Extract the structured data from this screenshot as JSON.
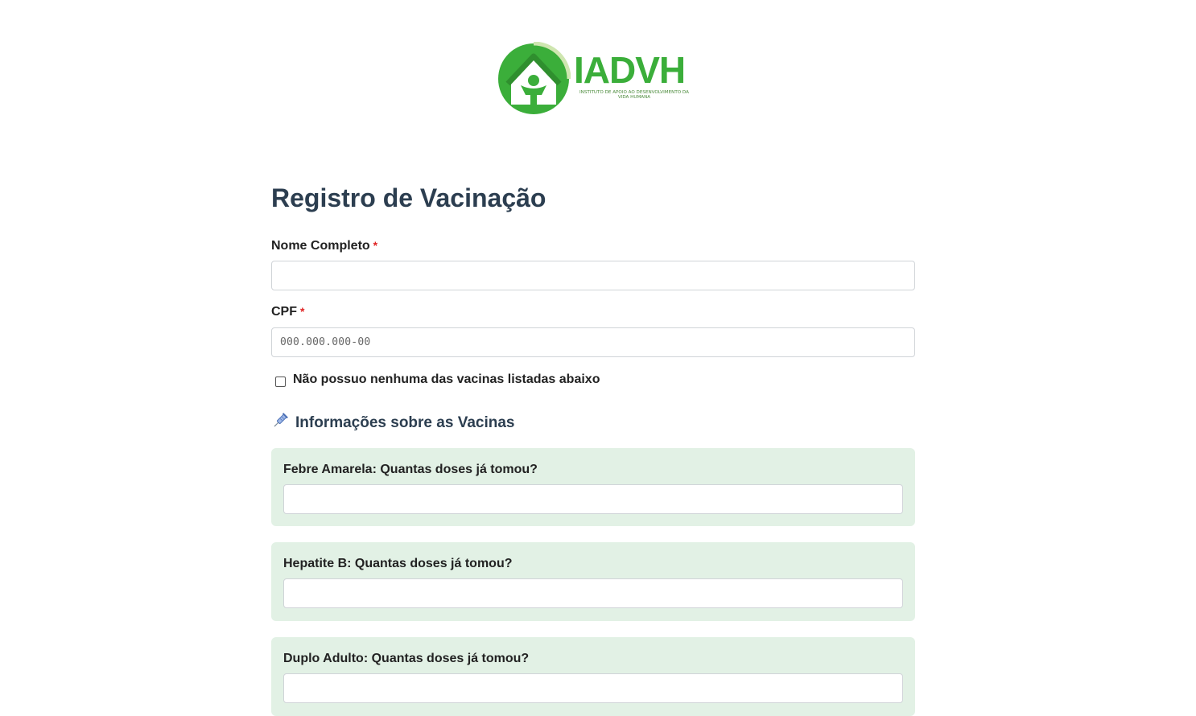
{
  "logo": {
    "text": "IADVH",
    "subtitle": "INSTITUTO DE APOIO AO DESENVOLVIMENTO DA VIDA HUMANA"
  },
  "form": {
    "title": "Registro de Vacinação",
    "name_label": "Nome Completo",
    "name_value": "",
    "cpf_label": "CPF",
    "cpf_placeholder": "000.000.000-00",
    "required_mark": "*",
    "no_vaccine_label": "Não possuo nenhuma das vacinas listadas abaixo",
    "no_vaccine_checked": false
  },
  "section": {
    "title": "Informações sobre as Vacinas",
    "icon": "syringe-icon"
  },
  "vaccines": [
    {
      "question": "Febre Amarela: Quantas doses já tomou?",
      "value": ""
    },
    {
      "question": "Hepatite B: Quantas doses já tomou?",
      "value": ""
    },
    {
      "question": "Duplo Adulto: Quantas doses já tomou?",
      "value": ""
    }
  ],
  "colors": {
    "brand_green": "#3bae3a",
    "card_bg": "#e2f1e5",
    "heading": "#2c3e50",
    "required": "#e02424"
  }
}
